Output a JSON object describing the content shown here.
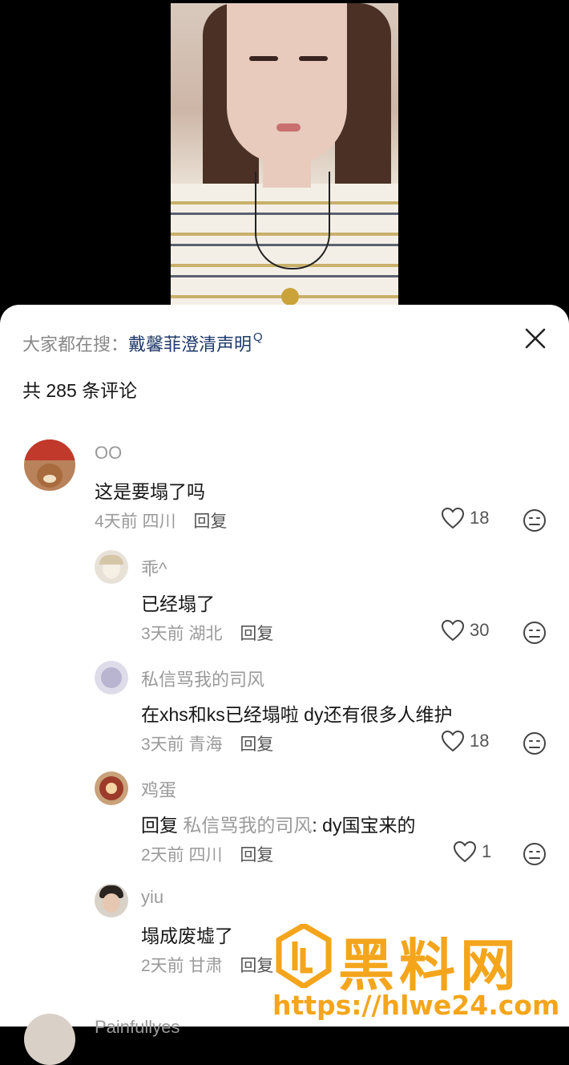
{
  "search_hint": {
    "prefix": "大家都在搜：",
    "keyword": "戴馨菲澄清声明",
    "search_icon": "search-icon"
  },
  "comment_count": "共 285 条评论",
  "comments": [
    {
      "name": "OO",
      "text": "这是要塌了吗",
      "time": "4天前",
      "location": "四川",
      "reply": "回复",
      "likes": "18"
    },
    {
      "name": "乖^",
      "text": "已经塌了",
      "time": "3天前",
      "location": "湖北",
      "reply": "回复",
      "likes": "30"
    },
    {
      "name": "私信骂我的司风",
      "text": "在xhs和ks已经塌啦 dy还有很多人维护",
      "time": "3天前",
      "location": "青海",
      "reply": "回复",
      "likes": "18"
    },
    {
      "name": "鸡蛋",
      "text_prefix": "回复 ",
      "mention": "私信骂我的司风",
      "text": ": dy国宝来的",
      "time": "2天前",
      "location": "四川",
      "reply": "回复",
      "likes": "1"
    },
    {
      "name": "yiu",
      "text": "塌成废墟了",
      "time": "2天前",
      "location": "甘肃",
      "reply": "回复",
      "likes": ""
    }
  ],
  "partial_next_name": "Painfullyes",
  "watermark": {
    "title": "黑料网",
    "url": "https://hlwe24.com"
  },
  "colors": {
    "accent_keyword": "#1f3a6b",
    "meta": "#9a9a9a",
    "watermark": "#f4a51c"
  }
}
